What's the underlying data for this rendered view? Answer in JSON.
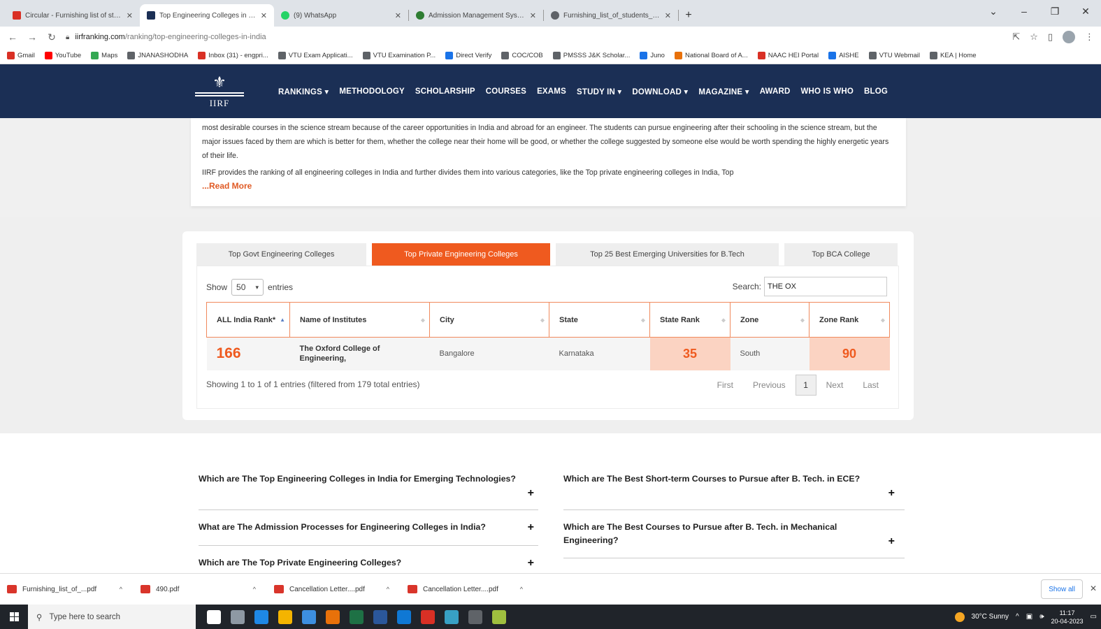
{
  "browser": {
    "tabs": [
      {
        "title": "Circular - Furnishing list of stude",
        "color": "#d93025",
        "active": false
      },
      {
        "title": "Top Engineering Colleges in India",
        "color": "#1b2f55",
        "active": true
      },
      {
        "title": "(9) WhatsApp",
        "color": "#25d366",
        "active": false
      },
      {
        "title": "Admission Management System",
        "color": "#2e7d32",
        "active": false
      },
      {
        "title": "Furnishing_list_of_students_admi",
        "color": "#5f6368",
        "active": false
      }
    ],
    "url_domain": "iirfranking.com",
    "url_path": "/ranking/top-engineering-colleges-in-india",
    "bookmarks": [
      {
        "label": "Gmail",
        "color": "#d93025"
      },
      {
        "label": "YouTube",
        "color": "#ff0000"
      },
      {
        "label": "Maps",
        "color": "#34a853"
      },
      {
        "label": "JNANASHODHA",
        "color": "#5f6368"
      },
      {
        "label": "Inbox (31) - engpri...",
        "color": "#d93025"
      },
      {
        "label": "VTU Exam Applicati...",
        "color": "#5f6368"
      },
      {
        "label": "VTU Examination P...",
        "color": "#5f6368"
      },
      {
        "label": "Direct Verify",
        "color": "#1a73e8"
      },
      {
        "label": "COC/COB",
        "color": "#5f6368"
      },
      {
        "label": "PMSSS J&K Scholar...",
        "color": "#5f6368"
      },
      {
        "label": "Juno",
        "color": "#1a73e8"
      },
      {
        "label": "National Board of A...",
        "color": "#e8710a"
      },
      {
        "label": "NAAC HEI Portal",
        "color": "#d93025"
      },
      {
        "label": "AISHE",
        "color": "#1a73e8"
      },
      {
        "label": "VTU Webmail",
        "color": "#5f6368"
      },
      {
        "label": "KEA | Home",
        "color": "#5f6368"
      }
    ]
  },
  "site": {
    "logo_text": "IIRF",
    "nav": [
      "RANKINGS ▾",
      "METHODOLOGY",
      "SCHOLARSHIP",
      "COURSES",
      "EXAMS",
      "STUDY IN ▾",
      "DOWNLOAD ▾",
      "MAGAZINE ▾",
      "AWARD",
      "WHO IS WHO",
      "BLOG"
    ]
  },
  "intro": {
    "paragraph1": "most desirable courses in the science stream because of the career opportunities in India and abroad for an engineer. The students can pursue engineering after their schooling in the science stream, but the major issues faced by them are which is better for them, whether the college near their home will be good, or whether the college suggested by someone else would be worth spending the highly energetic years of their life.",
    "paragraph2": "IIRF provides the ranking of all engineering colleges in India and further divides them into various categories, like the Top private engineering colleges in India, Top",
    "read_more": "...Read More"
  },
  "ranking": {
    "tabs": [
      {
        "label": "Top Govt Engineering Colleges",
        "active": false
      },
      {
        "label": "Top Private Engineering Colleges",
        "active": true
      },
      {
        "label": "Top 25 Best Emerging Universities for B.Tech",
        "active": false
      },
      {
        "label": "Top BCA College",
        "active": false
      }
    ],
    "show_label": "Show",
    "entries_value": "50",
    "entries_label": "entries",
    "search_label": "Search:",
    "search_value": "THE OX",
    "columns": [
      "ALL India Rank*",
      "Name of Institutes",
      "City",
      "State",
      "State Rank",
      "Zone",
      "Zone Rank"
    ],
    "rows": [
      {
        "all_india_rank": "166",
        "name": "The Oxford College of Engineering,",
        "city": "Bangalore",
        "state": "Karnataka",
        "state_rank": "35",
        "zone": "South",
        "zone_rank": "90"
      }
    ],
    "info": "Showing 1 to 1 of 1 entries (filtered from 179 total entries)",
    "pager": {
      "first": "First",
      "previous": "Previous",
      "current": "1",
      "next": "Next",
      "last": "Last"
    },
    "accent": "#ef5a1f"
  },
  "faq": [
    {
      "q": "Which are The Top Engineering Colleges in India for Emerging Technologies?"
    },
    {
      "q": "What are The Admission Processes for Engineering Colleges in India?"
    },
    {
      "q": "Which are The Top Private Engineering Colleges?"
    },
    {
      "q": "Which are The Best Short-term Courses to Pursue after B. Tech. in ECE?"
    },
    {
      "q": "Which are The Best Courses to Pursue after B. Tech. in Mechanical Engineering?"
    }
  ],
  "downloads": {
    "items": [
      "Furnishing_list_of_...pdf",
      "490.pdf",
      "Cancellation Letter....pdf",
      "Cancellation Letter....pdf"
    ],
    "show_all": "Show all"
  },
  "taskbar": {
    "search_placeholder": "Type here to search",
    "weather": "30°C Sunny",
    "time": "11:17",
    "date": "20-04-2023",
    "app_colors": [
      "#ffffff",
      "#8e99a4",
      "#1e88e5",
      "#f4b400",
      "#3d8fe0",
      "#e8710a",
      "#1e7145",
      "#2b579a",
      "#0f78d4",
      "#d93025",
      "#38a0c4",
      "#5f6368",
      "#9fbf3f"
    ]
  }
}
